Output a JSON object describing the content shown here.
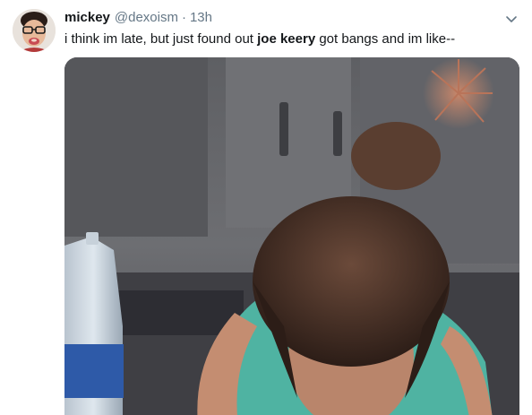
{
  "tweet": {
    "author_name": "mickey",
    "author_handle": "@dexoism",
    "separator": "·",
    "timestamp": "13h",
    "text_before": "i think im late, but just found out ",
    "text_bold": "joe keery",
    "text_after": " got bangs and im like--",
    "media_type": "animated-gif",
    "menu_icon": "chevron-down-icon"
  },
  "colors": {
    "text_primary": "#14171a",
    "text_secondary": "#657786",
    "background": "#ffffff"
  }
}
